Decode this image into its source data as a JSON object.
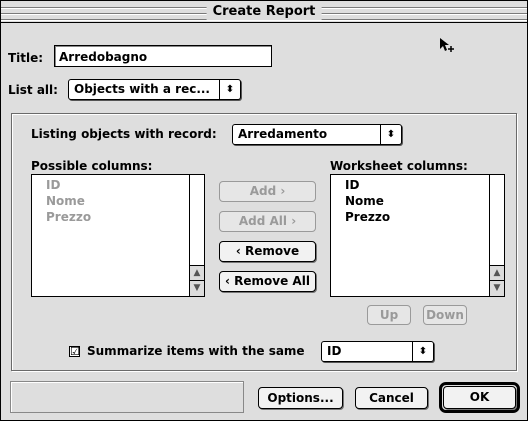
{
  "window": {
    "title": "Create Report"
  },
  "title_field": {
    "label": "Title:",
    "value": "Arredobagno"
  },
  "list_all": {
    "label": "List all:",
    "selected": "Objects with a rec..."
  },
  "listing": {
    "label": "Listing objects with record:",
    "selected": "Arredamento"
  },
  "possible_columns": {
    "label": "Possible columns:",
    "items": [
      "ID",
      "Nome",
      "Prezzo"
    ]
  },
  "worksheet_columns": {
    "label": "Worksheet columns:",
    "items": [
      "ID",
      "Nome",
      "Prezzo"
    ]
  },
  "buttons": {
    "add": "Add ›",
    "add_all": "Add All ›",
    "remove": "‹ Remove",
    "remove_all": "‹ Remove All",
    "up": "Up",
    "down": "Down",
    "options": "Options...",
    "cancel": "Cancel",
    "ok": "OK"
  },
  "summarize": {
    "label": "Summarize items with the same",
    "checked": true,
    "selected": "ID"
  },
  "icons": {
    "popup_arrow": "⬍",
    "scroll_up": "▲",
    "scroll_down": "▼",
    "check": "☑"
  },
  "colors": {
    "window_bg": "#dedede",
    "disabled_text": "#9a9a9a"
  }
}
